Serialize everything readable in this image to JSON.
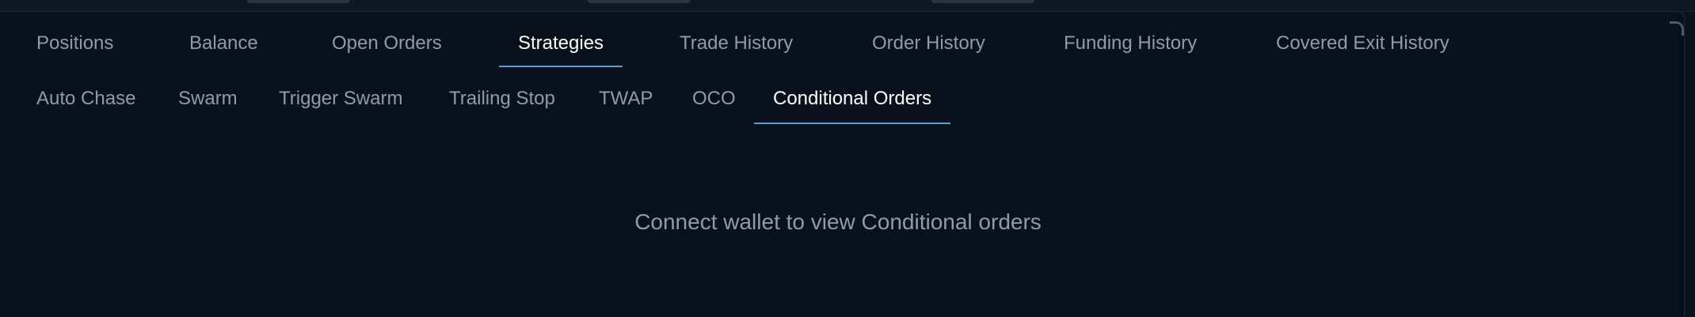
{
  "tabs": [
    {
      "label": "Positions"
    },
    {
      "label": "Balance"
    },
    {
      "label": "Open Orders"
    },
    {
      "label": "Strategies"
    },
    {
      "label": "Trade History"
    },
    {
      "label": "Order History"
    },
    {
      "label": "Funding History"
    },
    {
      "label": "Covered Exit History"
    }
  ],
  "active_tab": "Strategies",
  "subtabs": [
    {
      "label": "Auto Chase"
    },
    {
      "label": "Swarm"
    },
    {
      "label": "Trigger Swarm"
    },
    {
      "label": "Trailing Stop"
    },
    {
      "label": "TWAP"
    },
    {
      "label": "OCO"
    },
    {
      "label": "Conditional Orders"
    }
  ],
  "active_subtab": "Conditional Orders",
  "empty_message": "Connect wallet to view Conditional orders",
  "colors": {
    "background": "#08111b",
    "text_muted": "#8e9bab",
    "text_active": "#ffffff",
    "accent": "#4aa3e0"
  }
}
